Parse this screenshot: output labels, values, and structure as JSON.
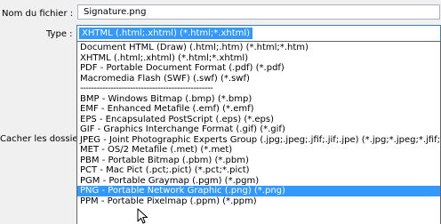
{
  "dialog": {
    "filename_label": "Nom du fichier :",
    "filename_value": "Signature.png",
    "type_label": "Type :",
    "type_selected": "XHTML (.html;.xhtml) (*.html;*.xhtml)",
    "hidden_folders_label": "Cacher les dossiers"
  },
  "type_options": [
    {
      "label": "Document HTML (Draw) (.html;.htm) (*.html;*.htm)"
    },
    {
      "label": "XHTML (.html;.xhtml) (*.html;*.xhtml)"
    },
    {
      "label": "PDF - Portable Document Format (.pdf) (*.pdf)"
    },
    {
      "label": "Macromedia Flash (SWF) (.swf) (*.swf)"
    },
    {
      "label": "------------------------------------------------"
    },
    {
      "label": "BMP - Windows Bitmap (.bmp) (*.bmp)"
    },
    {
      "label": "EMF - Enhanced Metafile (.emf) (*.emf)"
    },
    {
      "label": "EPS - Encapsulated PostScript (.eps) (*.eps)"
    },
    {
      "label": "GIF - Graphics Interchange Format (.gif) (*.gif)"
    },
    {
      "label": "JPEG - Joint Photographic Experts Group (.jpg;.jpeg;.jfif;.jif;.jpe) (*.jpg;*.jpeg;*.jfif;*.jif;*.jpe)"
    },
    {
      "label": "MET - OS/2 Metafile (.met) (*.met)"
    },
    {
      "label": "PBM - Portable Bitmap (.pbm) (*.pbm)"
    },
    {
      "label": "PCT - Mac Pict (.pct;.pict) (*.pct;*.pict)"
    },
    {
      "label": "PGM - Portable Graymap (.pgm) (*.pgm)"
    },
    {
      "label": "PNG - Portable Network Graphic (.png) (*.png)",
      "selected": true
    },
    {
      "label": "PPM - Portable Pixelmap (.ppm) (*.ppm)"
    }
  ],
  "colors": {
    "selection": "#3399ff",
    "window_bg": "#f0f0f0",
    "list_bg": "#ffffff"
  },
  "icons": {
    "cursor": "mouse-pointer-icon"
  }
}
